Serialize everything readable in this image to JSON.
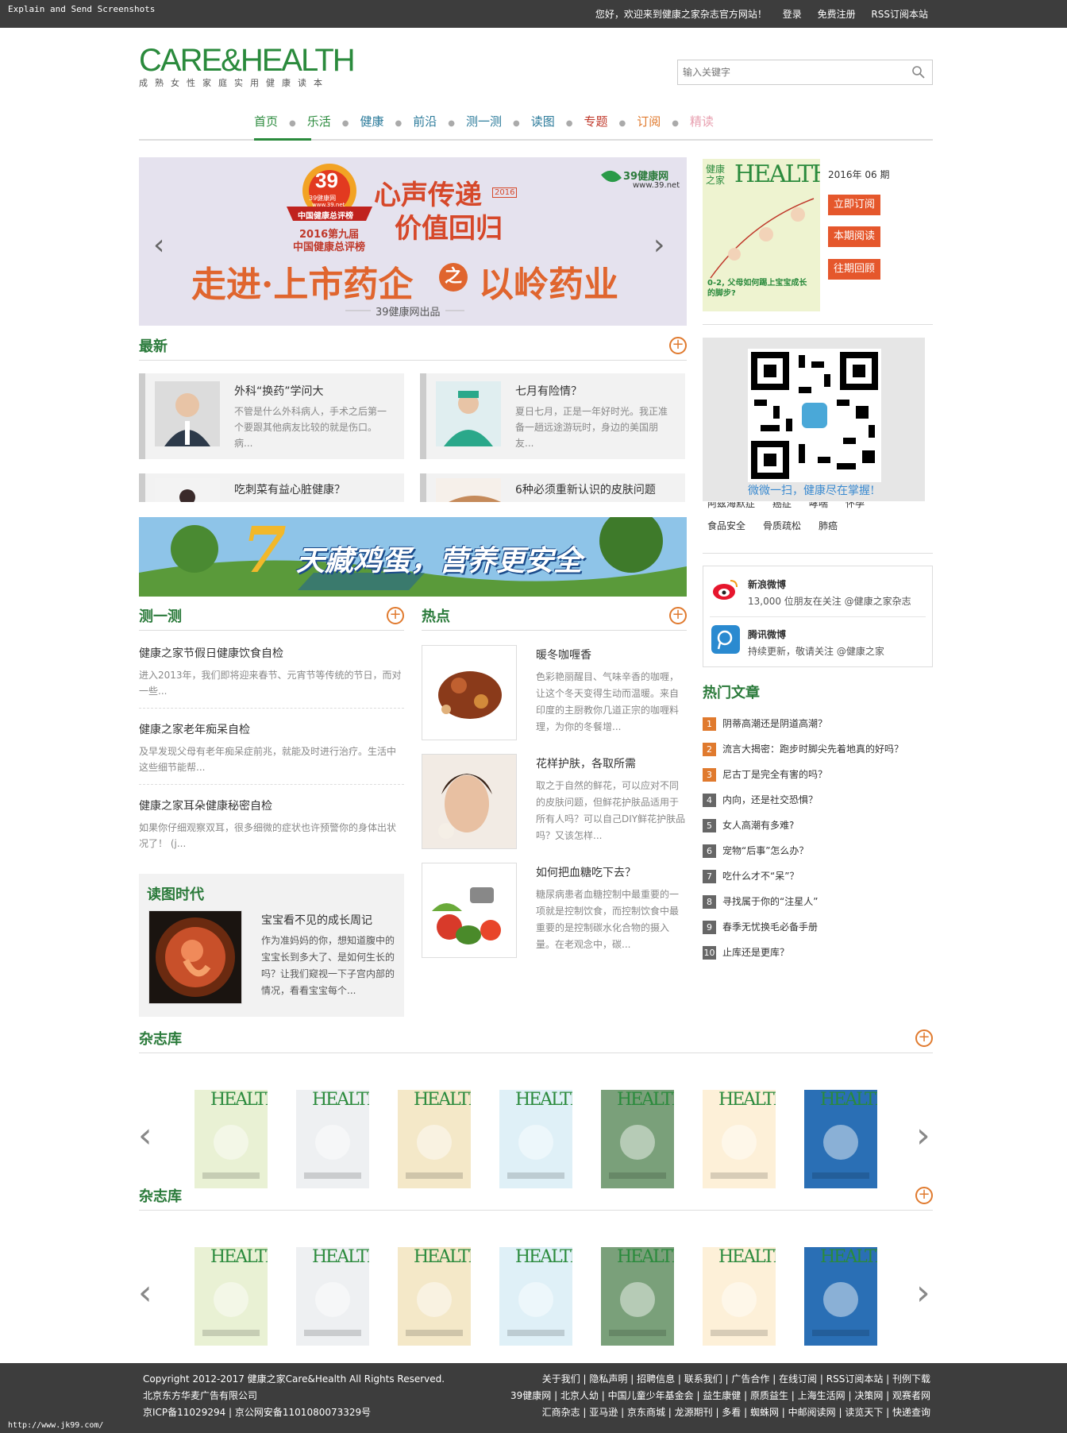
{
  "topbar": {
    "app_label": "Explain and Send Screenshots",
    "welcome": "您好，欢迎来到健康之家杂志官方网站！",
    "login": "登录",
    "register": "免费注册",
    "rss": "RSS订阅本站"
  },
  "logo": {
    "main": "CARE&HEALTH",
    "sub": "成熟女性家庭实用健康读本"
  },
  "search": {
    "placeholder": "输入关键字",
    "icon": "search-icon"
  },
  "nav": [
    "首页",
    "乐活",
    "健康",
    "前沿",
    "测一测",
    "读图",
    "专题",
    "订阅",
    "精读"
  ],
  "nav_colors": [
    "#2a8a3c",
    "#2a8a3c",
    "#2a7a9a",
    "#2a7a9a",
    "#2a7a9a",
    "#2a7a9a",
    "#c0392b",
    "#e07a2e",
    "#e8a0b0"
  ],
  "banner": {
    "badge_num": "39",
    "badge_site": "39健康网",
    "badge_url": "www.39.net",
    "badge_ribbon": "中国健康总评榜",
    "event_line1": "2016第九届",
    "event_line2": "中国健康总评榜",
    "slogan1": "心声传递",
    "slogan2": "价值回归",
    "year_stamp": "2016",
    "main": "走进·上市药企",
    "circle": "之",
    "company": "以岭药业",
    "brand": "39健康网",
    "brand_url": "www.39.net",
    "footer": "39健康网出品"
  },
  "magazine": {
    "issue": "2016年 06 期",
    "subscribe": "立即订阅",
    "read_now": "本期阅读",
    "past": "往期回顾",
    "cover_title": "健康之家",
    "cover_health": "HEALTH",
    "cover_caption": "0-2, 父母如何踢上宝宝成长的脚步?"
  },
  "latest": {
    "title": "最新",
    "items": [
      {
        "title": "外科“换药”学问大",
        "desc": "不管是什么外科病人，手术之后第一个要跟其他病友比较的就是伤口。病..."
      },
      {
        "title": "七月有险情？",
        "desc": "夏日七月，正是一年好时光。我正准备一趟远途游玩时，身边的美国朋友..."
      },
      {
        "title": "吃刺菜有益心脏健康？",
        "desc": ""
      },
      {
        "title": "6种必须重新认识的皮肤问题",
        "desc": ""
      }
    ]
  },
  "qr": {
    "caption": "微微一扫，健康尽在掌握!"
  },
  "tags": {
    "row1": [
      "阿兹海默症",
      "癌症",
      "哮喘",
      "怀孕"
    ],
    "row2": [
      "食品安全",
      "骨质疏松",
      "肺癌"
    ]
  },
  "ad": {
    "text": "天藏鸡蛋，营养更安全",
    "number": "7"
  },
  "social": [
    {
      "name": "新浪微博",
      "desc": "13,000 位朋友在关注 @健康之家杂志"
    },
    {
      "name": "腾讯微博",
      "desc": "持续更新，敬请关注 @健康之家"
    }
  ],
  "hot_articles": {
    "title": "热门文章",
    "items": [
      "阴蒂高潮还是阴道高潮？",
      "流言大揭密：跑步时脚尖先着地真的好吗？",
      "尼古丁是完全有害的吗？",
      "内向，还是社交恐惧？",
      "女人高潮有多难?",
      "宠物“后事”怎么办？",
      "吃什么才不“呆”？",
      "寻找属于你的“注星人”",
      "春季无忧换毛必备手册",
      "止库还是更库？"
    ]
  },
  "test": {
    "title": "测一测",
    "items": [
      {
        "title": "健康之家节假日健康饮食自检",
        "desc": "进入2013年，我们即将迎来春节、元宵节等传统的节日，而对一些..."
      },
      {
        "title": "健康之家老年痴呆自检",
        "desc": "及早发现父母有老年痴呆症前兆，就能及时进行治疗。生活中这些细节能帮..."
      },
      {
        "title": "健康之家耳朵健康秘密自检",
        "desc": "如果你仔细观察双耳，很多细微的症状也许预警你的身体出状况了！ (j..."
      }
    ]
  },
  "hot": {
    "title": "热点",
    "items": [
      {
        "title": "暖冬咖喱香",
        "desc": "色彩艳丽醒目、气味辛香的咖喱，让这个冬天变得生动而温暖。来自印度的主厨教你几道正宗的咖喱料理，为你的冬餐增..."
      },
      {
        "title": "花样护肤，各取所需",
        "desc": "取之于自然的鲜花，可以应对不同的皮肤问题，但鲜花护肤品适用于所有人吗？可以自己DIY鲜花护肤品吗？又该怎样..."
      },
      {
        "title": "如何把血糖吃下去？",
        "desc": "糖尿病患者血糖控制中最重要的一项就是控制饮食，而控制饮食中最重要的是控制碳水化合物的摄入量。在老观念中，碳..."
      }
    ]
  },
  "reading": {
    "title": "读图时代",
    "item_title": "宝宝看不见的成长周记",
    "item_desc": "作为准妈妈的你，想知道腹中的宝宝长到多大了、是如何生长的吗？让我们窥视一下子宫内部的情况，看看宝宝每个..."
  },
  "mag_library": {
    "title": "杂志库",
    "covers": [
      "#e9f1d4",
      "#eef0f2",
      "#f4e8c8",
      "#dff0f7",
      "#7aa07a",
      "#fdf0d8",
      "#2a6fb5"
    ]
  },
  "footer": {
    "copyright": "Copyright 2012-2017 健康之家Care&Health All Rights Reserved.",
    "company": "北京东方华麦广告有限公司",
    "icp": "京ICP备11029294 | 京公网安备1101080073329号",
    "row1": "关于我们 | 隐私声明 | 招聘信息 | 联系我们 | 广告合作 | 在线订阅 | RSS订阅本站 | 刊例下载",
    "row2": "39健康网 | 北京人幼 | 中国儿童少年基金会 | 益生康健 | 原质益生 | 上海生活网 | 决策网 | 观赛者网",
    "row3": "汇商杂志 | 亚马逊 | 京东商城 | 龙源期刊 | 多看 | 蜘蛛网 | 中邮阅读网 | 读览天下 | 快递查询",
    "url": "http://www.jk99.com/"
  }
}
